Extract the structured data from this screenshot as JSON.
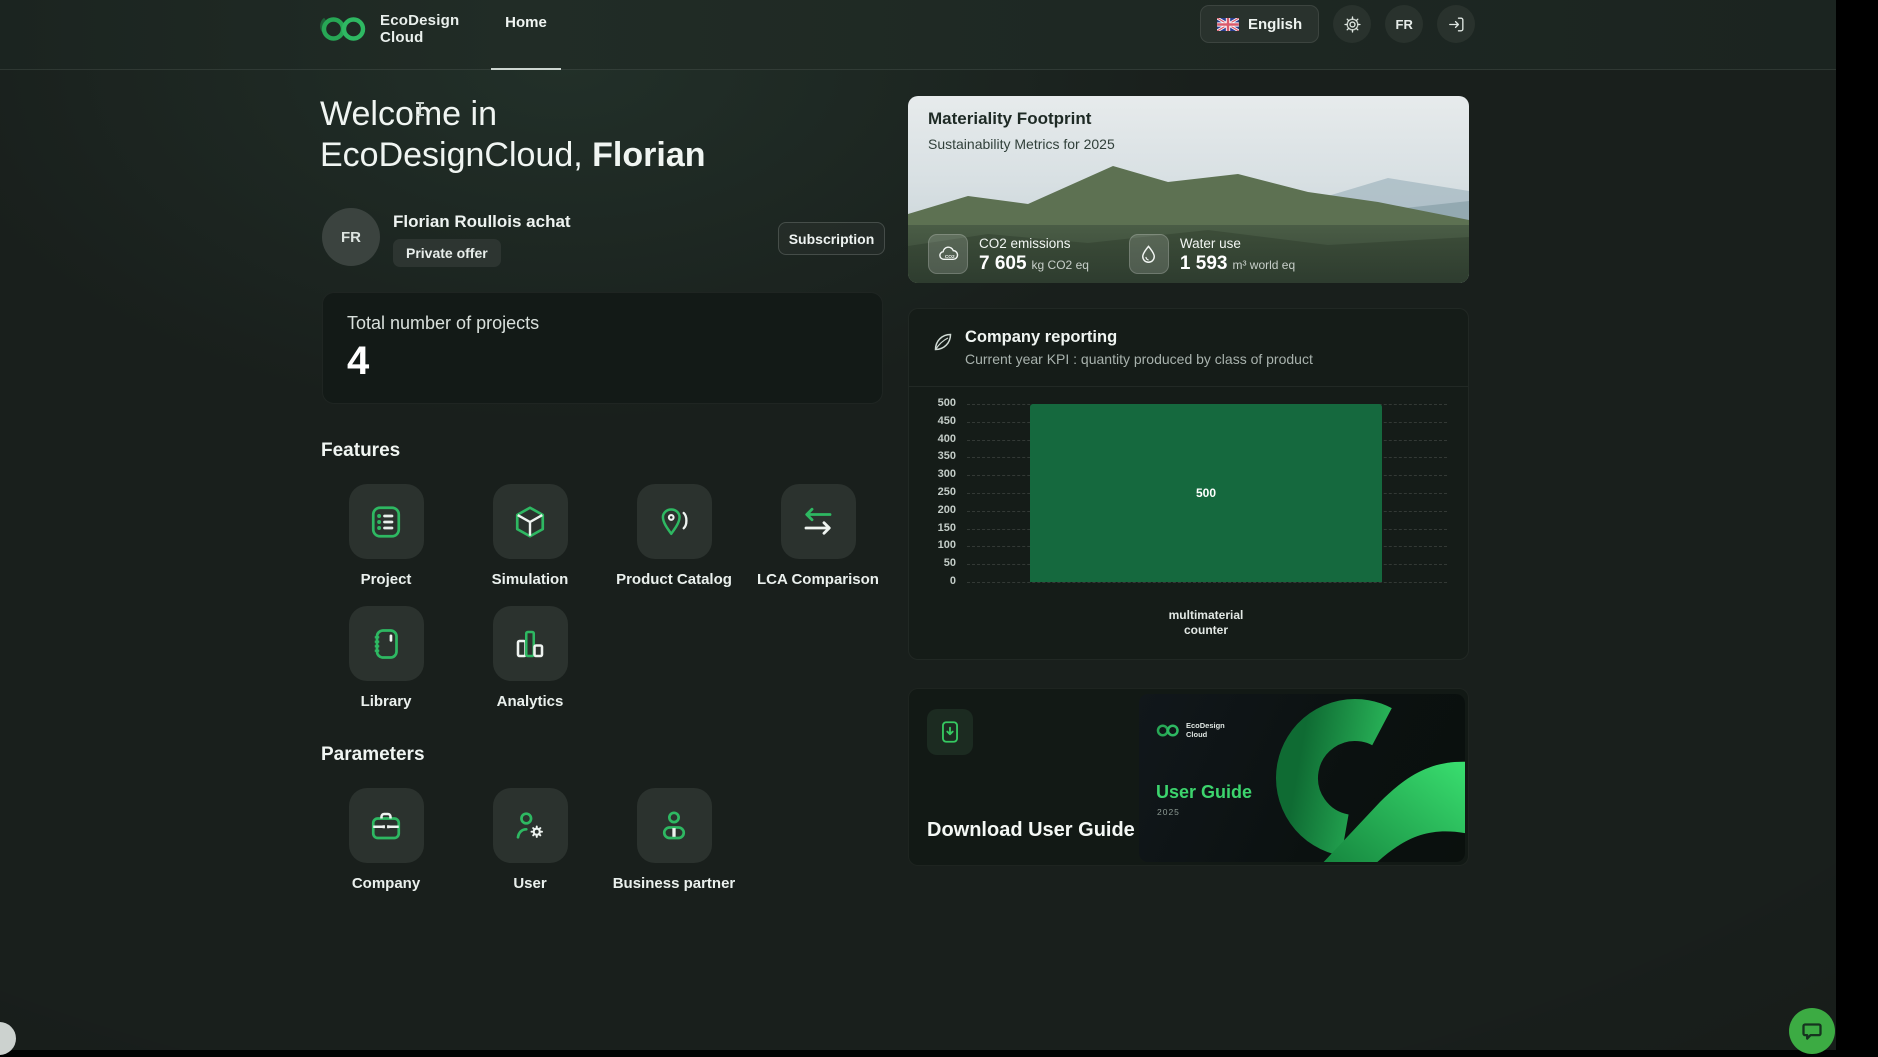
{
  "header": {
    "brand_line1": "EcoDesign",
    "brand_line2": "Cloud",
    "nav_home": "Home",
    "language_label": "English",
    "user_initials": "FR"
  },
  "welcome": {
    "line1": "Welcome in",
    "line2_prefix": "EcoDesignCloud, ",
    "line2_name": "Florian"
  },
  "profile": {
    "avatar_initials": "FR",
    "name": "Florian Roullois achat",
    "offer_badge": "Private offer",
    "subscription_button": "Subscription"
  },
  "projects_card": {
    "label": "Total number of projects",
    "count": "4"
  },
  "features": {
    "heading": "Features",
    "items": [
      {
        "label": "Project",
        "icon": "project-list-icon"
      },
      {
        "label": "Simulation",
        "icon": "simulation-cube-icon"
      },
      {
        "label": "Product Catalog",
        "icon": "product-catalog-tag-icon"
      },
      {
        "label": "LCA Comparison",
        "icon": "lca-comparison-arrows-icon"
      },
      {
        "label": "Library",
        "icon": "library-notebook-icon"
      },
      {
        "label": "Analytics",
        "icon": "analytics-bars-icon"
      }
    ]
  },
  "parameters": {
    "heading": "Parameters",
    "items": [
      {
        "label": "Company",
        "icon": "company-briefcase-icon"
      },
      {
        "label": "User",
        "icon": "user-gear-icon"
      },
      {
        "label": "Business partner",
        "icon": "business-partner-icon"
      }
    ]
  },
  "materiality": {
    "title": "Materiality Footprint",
    "subtitle": "Sustainability Metrics for 2025",
    "stats": [
      {
        "icon": "co2-cloud-icon",
        "label": "CO2 emissions",
        "value": "7 605",
        "unit": "kg CO2 eq"
      },
      {
        "icon": "water-drop-icon",
        "label": "Water use",
        "value": "1 593",
        "unit": "m³ world eq"
      }
    ]
  },
  "reporting": {
    "title": "Company reporting",
    "subtitle": "Current year KPI : quantity produced by class of product"
  },
  "chart_data": {
    "type": "bar",
    "categories": [
      "multimaterial\ncounter"
    ],
    "values": [
      500
    ],
    "bar_labels": [
      "500"
    ],
    "title": "",
    "xlabel": "",
    "ylabel": "",
    "ylim": [
      0,
      500
    ],
    "yticks": [
      0,
      50,
      100,
      150,
      200,
      250,
      300,
      350,
      400,
      450,
      500
    ],
    "grid": "dashed-horizontal",
    "legend": "none",
    "bar_color": "#15693e"
  },
  "guide": {
    "download_label": "Download User Guide",
    "cover_brand_line1": "EcoDesign",
    "cover_brand_line2": "Cloud",
    "cover_title": "User Guide",
    "cover_year": "2025"
  },
  "colors": {
    "accent_green": "#2eb862",
    "chat_green": "#3cab43"
  }
}
